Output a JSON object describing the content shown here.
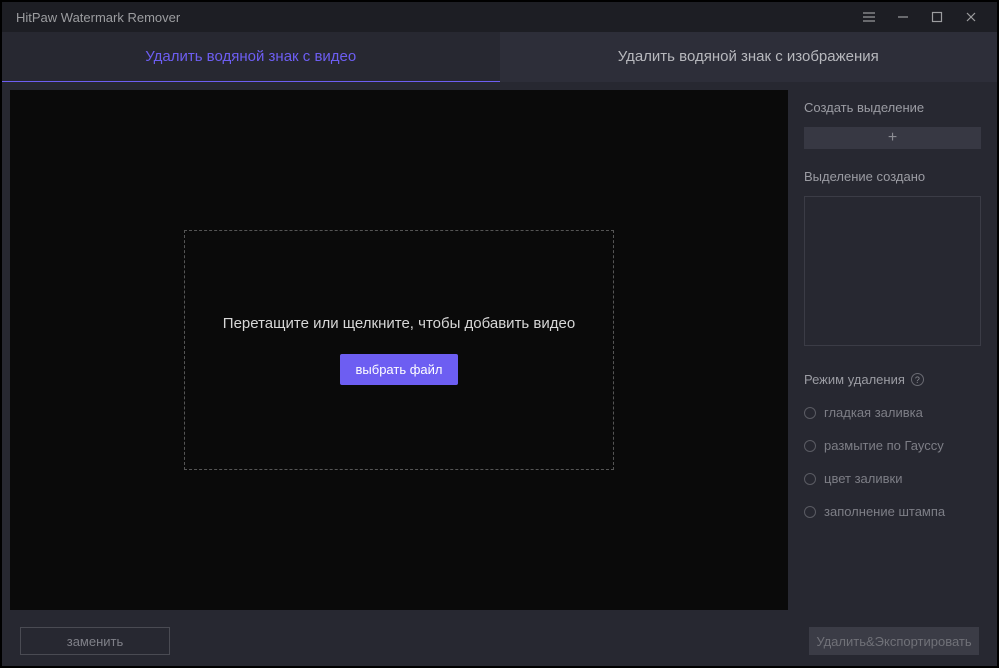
{
  "window": {
    "title": "HitPaw Watermark Remover"
  },
  "tabs": {
    "video": "Удалить водяной знак с видео",
    "image": "Удалить водяной знак с изображения"
  },
  "dropzone": {
    "hint": "Перетащите или щелкните, чтобы добавить видео",
    "select_label": "выбрать файл"
  },
  "sidebar": {
    "create_selection_label": "Создать выделение",
    "add_icon": "+",
    "selection_created_label": "Выделение создано",
    "mode_title": "Режим удаления",
    "help_glyph": "?",
    "modes": [
      "гладкая заливка",
      "размытие по Гауссу",
      "цвет заливки",
      "заполнение штампа"
    ]
  },
  "footer": {
    "replace_label": "заменить",
    "export_label": "Удалить&Экспортировать"
  }
}
